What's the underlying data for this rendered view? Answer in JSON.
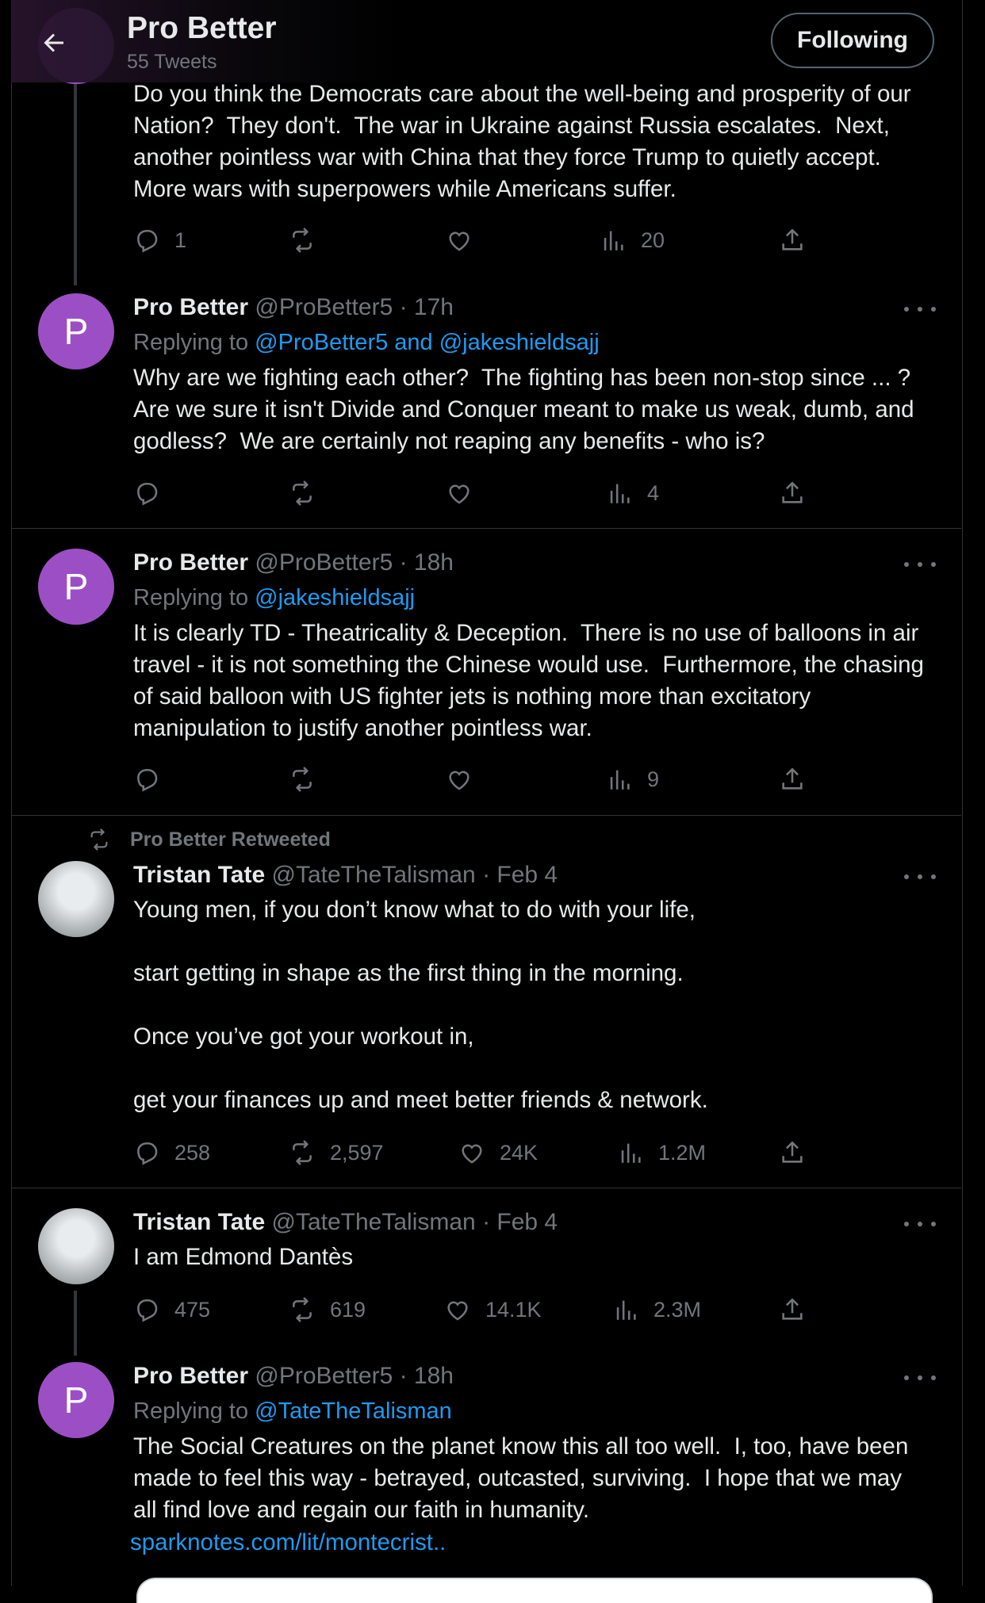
{
  "header": {
    "title": "Pro Better",
    "subtitle": "55 Tweets",
    "follow_label": "Following"
  },
  "tweets": [
    {
      "body": "Do you think the Democrats care about the well-being and prosperity of our Nation?  They don't.  The war in Ukraine against Russia escalates.  Next, another pointless war with China that they force Trump to quietly accept.  More wars with superpowers while Americans suffer.",
      "replies": "1",
      "retweets": "",
      "likes": "",
      "views": "20"
    },
    {
      "name": "Pro Better",
      "meta": "@ProBetter5 · 17h",
      "replying_prefix": "Replying to ",
      "replying_to": "@ProBetter5 and @jakeshieldsajj",
      "body": "Why are we fighting each other?  The fighting has been non-stop since ... ?  Are we sure it isn't Divide and Conquer meant to make us weak, dumb, and godless?  We are certainly not reaping any benefits - who is?",
      "avatar_letter": "P",
      "replies": "",
      "retweets": "",
      "likes": "",
      "views": "4"
    },
    {
      "name": "Pro Better",
      "meta": "@ProBetter5 · 18h",
      "replying_prefix": "Replying to ",
      "replying_to": "@jakeshieldsajj",
      "body": "It is clearly TD - Theatricality & Deception.  There is no use of balloons in air travel - it is not something the Chinese would use.  Furthermore, the chasing of said balloon with US fighter jets is nothing more than excitatory manipulation to justify another pointless war.",
      "avatar_letter": "P",
      "replies": "",
      "retweets": "",
      "likes": "",
      "views": "9"
    },
    {
      "retweeted_label": "Pro Better Retweeted",
      "name": "Tristan Tate",
      "meta": "@TateTheTalisman · Feb 4",
      "body": "Young men, if you don’t know what to do with your life,\n\nstart getting in shape as the first thing in the morning.\n\nOnce you’ve got your workout in,\n\nget your finances up and meet better friends & network.",
      "replies": "258",
      "retweets": "2,597",
      "likes": "24K",
      "views": "1.2M"
    },
    {
      "name": "Tristan Tate",
      "meta": "@TateTheTalisman · Feb 4",
      "body": "I am Edmond Dantès",
      "replies": "475",
      "retweets": "619",
      "likes": "14.1K",
      "views": "2.3M"
    },
    {
      "name": "Pro Better",
      "meta": "@ProBetter5 · 18h",
      "replying_prefix": "Replying to ",
      "replying_to": "@TateTheTalisman",
      "body": "The Social Creatures on the planet know this all too well.  I, too, have been made to feel this way - betrayed, outcasted, surviving.  I hope that we may all find love and regain our faith in humanity.",
      "link": "sparknotes.com/lit/montecrist..",
      "avatar_letter": "P"
    }
  ]
}
